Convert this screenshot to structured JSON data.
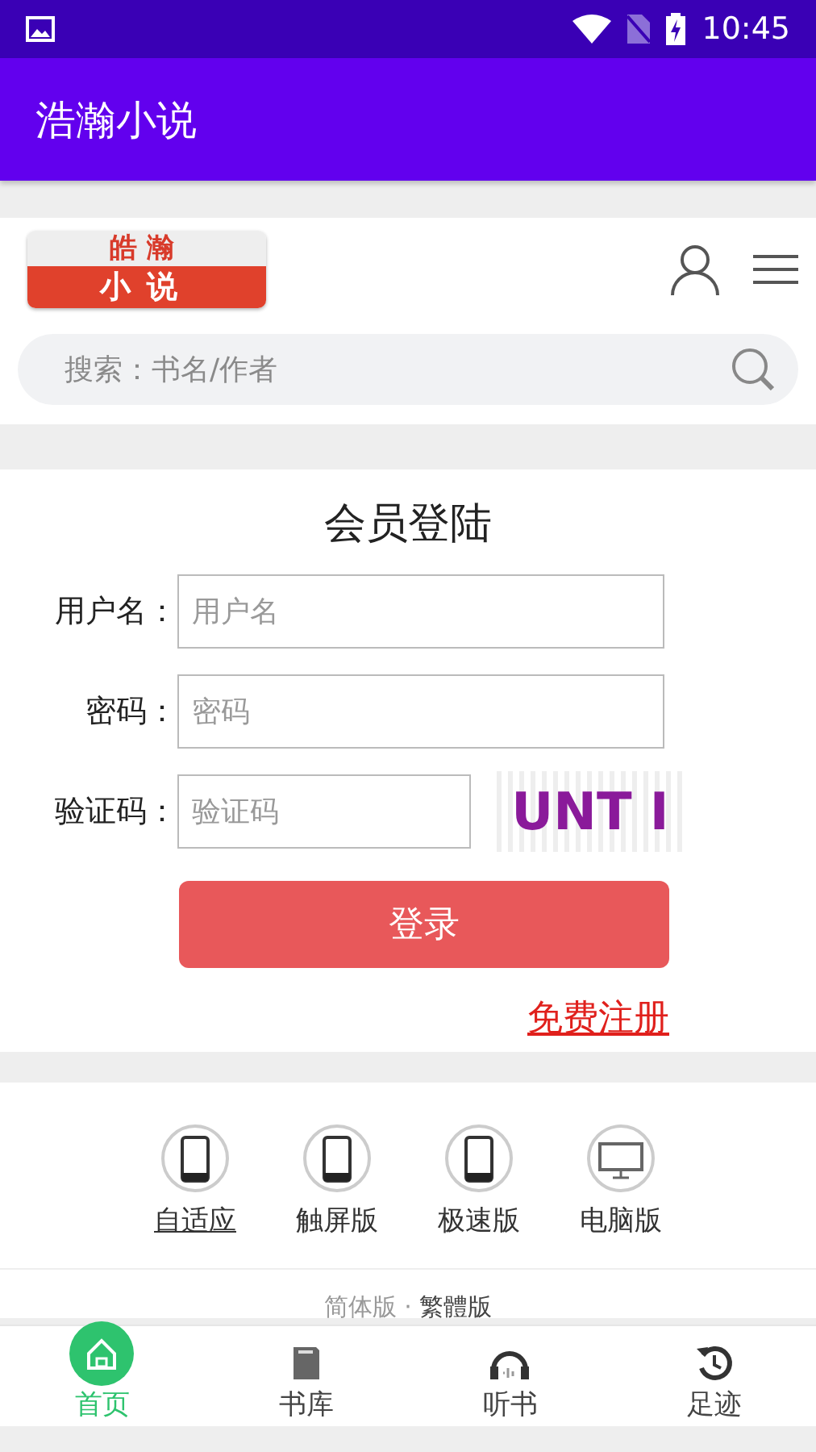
{
  "status_bar": {
    "time": "10:45"
  },
  "app_bar": {
    "title": "浩瀚小说"
  },
  "site_header": {
    "logo_top": "皓瀚",
    "logo_bottom": "小说",
    "search": {
      "placeholder": "搜索：书名/作者"
    }
  },
  "login": {
    "title": "会员登陆",
    "fields": [
      {
        "label": "用户名：",
        "placeholder": "用户名",
        "kind": "text"
      },
      {
        "label": "密码：",
        "placeholder": "密码",
        "kind": "password"
      },
      {
        "label": "验证码：",
        "placeholder": "验证码",
        "kind": "captcha",
        "captcha": "UNT I"
      }
    ],
    "submit": "登录",
    "register_link": "免费注册"
  },
  "versions": [
    {
      "label": "自适应",
      "kind": "phone",
      "selected": true
    },
    {
      "label": "触屏版",
      "kind": "phone",
      "selected": false
    },
    {
      "label": "极速版",
      "kind": "phone",
      "selected": false
    },
    {
      "label": "电脑版",
      "kind": "desktop",
      "selected": false
    }
  ],
  "language": {
    "simplified": "简体版",
    "separator": "·",
    "traditional": "繁體版"
  },
  "bottom_nav": [
    {
      "label": "首页",
      "kind": "home",
      "selected": true
    },
    {
      "label": "书库",
      "kind": "book",
      "selected": false
    },
    {
      "label": "听书",
      "kind": "headphones",
      "selected": false
    },
    {
      "label": "足迹",
      "kind": "history",
      "selected": false
    }
  ]
}
